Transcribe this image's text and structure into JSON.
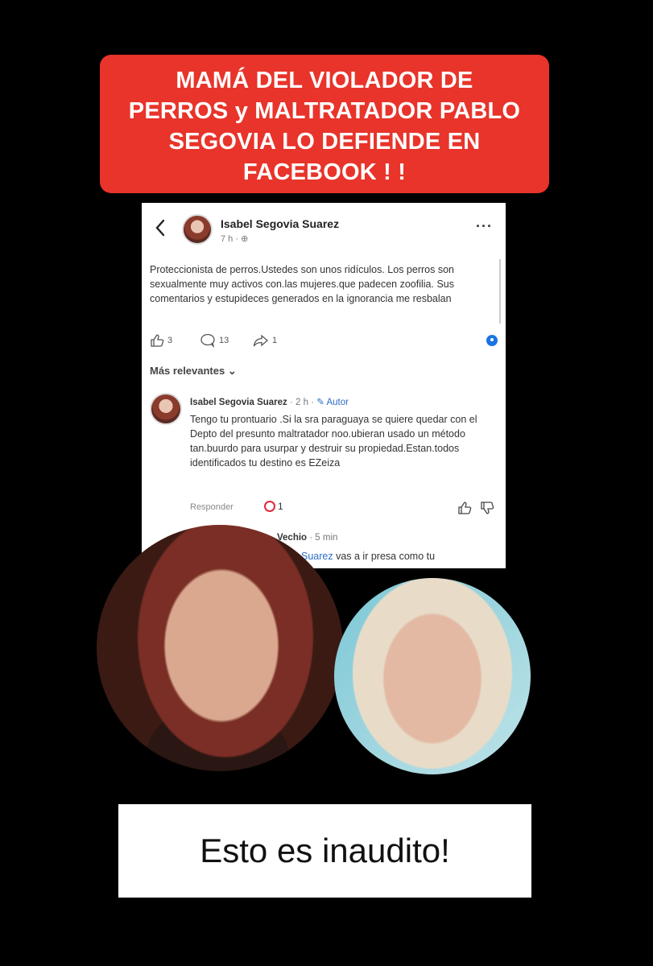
{
  "headline": {
    "lines": [
      "MAMÁ DEL VIOLADOR DE",
      "PERROS y MALTRATADOR  PABLO",
      "SEGOVIA LO DEFIENDE EN",
      "FACEBOOK ! !"
    ],
    "background_color": "#e8342a"
  },
  "post": {
    "author": "Isabel Segovia Suarez",
    "meta": "7 h · ⊕",
    "body": "Proteccionista de perros.Ustedes son unos ridículos. Los perros son sexualmente muy activos con.las mujeres.que padecen zoofilia. Sus comentarios y estupideces generados en la ignorancia me resbalan",
    "likes": "3",
    "comments": "13",
    "shares": "1",
    "icons": [
      "back-icon",
      "more-icon",
      "like-icon",
      "comment-icon",
      "share-icon"
    ]
  },
  "sort": {
    "label": "Más relevantes ⌄"
  },
  "comment": {
    "author": "Isabel Segovia Suarez",
    "time": " · 2 h · ",
    "badge": "✎ Autor",
    "text": "Tengo tu prontuario .Si la sra paraguaya se quiere quedar con el Depto  del presunto maltratador noo.ubieran usado un método  tan.buurdo para usurpar y destruir su propiedad.Estan.todos identificados tu destino es EZeiza",
    "reply_label": "Responder",
    "love_count": "1"
  },
  "reply": {
    "author_fragment": "Vechio",
    "time": " · 5 min",
    "mention_fragment": "Suarez",
    "text_fragment": " vas a ir presa como tu"
  },
  "caption": {
    "text": "Esto es inaudito!"
  }
}
